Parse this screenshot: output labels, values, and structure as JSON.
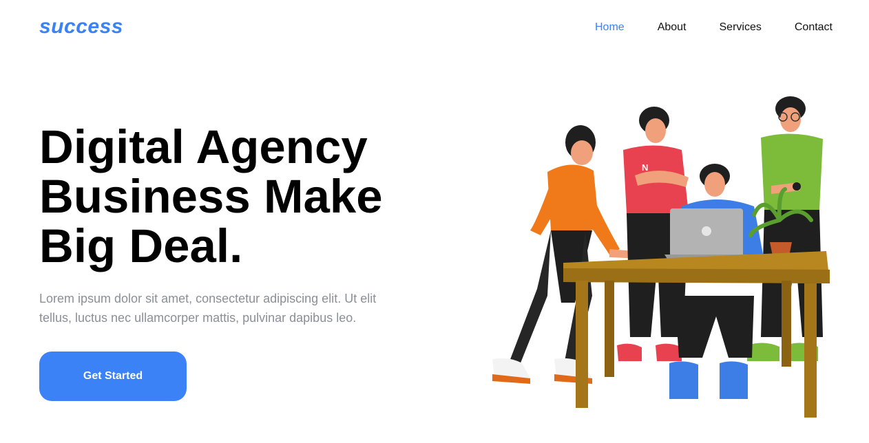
{
  "header": {
    "logo": "success",
    "nav": [
      {
        "label": "Home",
        "active": true
      },
      {
        "label": "About",
        "active": false
      },
      {
        "label": "Services",
        "active": false
      },
      {
        "label": "Contact",
        "active": false
      }
    ]
  },
  "hero": {
    "title_line1": "Digital Agency",
    "title_line2": "Business Make",
    "title_line3": "Big Deal.",
    "text_line1": "Lorem ipsum dolor sit amet, consectetur adipiscing elit. Ut elit",
    "text_line2": "tellus, luctus nec ullamcorper mattis, pulvinar dapibus leo.",
    "cta_label": "Get Started",
    "illustration": {
      "shirt_letter": "N"
    }
  },
  "colors": {
    "accent": "#3b82f6",
    "title": "#000000",
    "body_text": "#8a8f98"
  }
}
